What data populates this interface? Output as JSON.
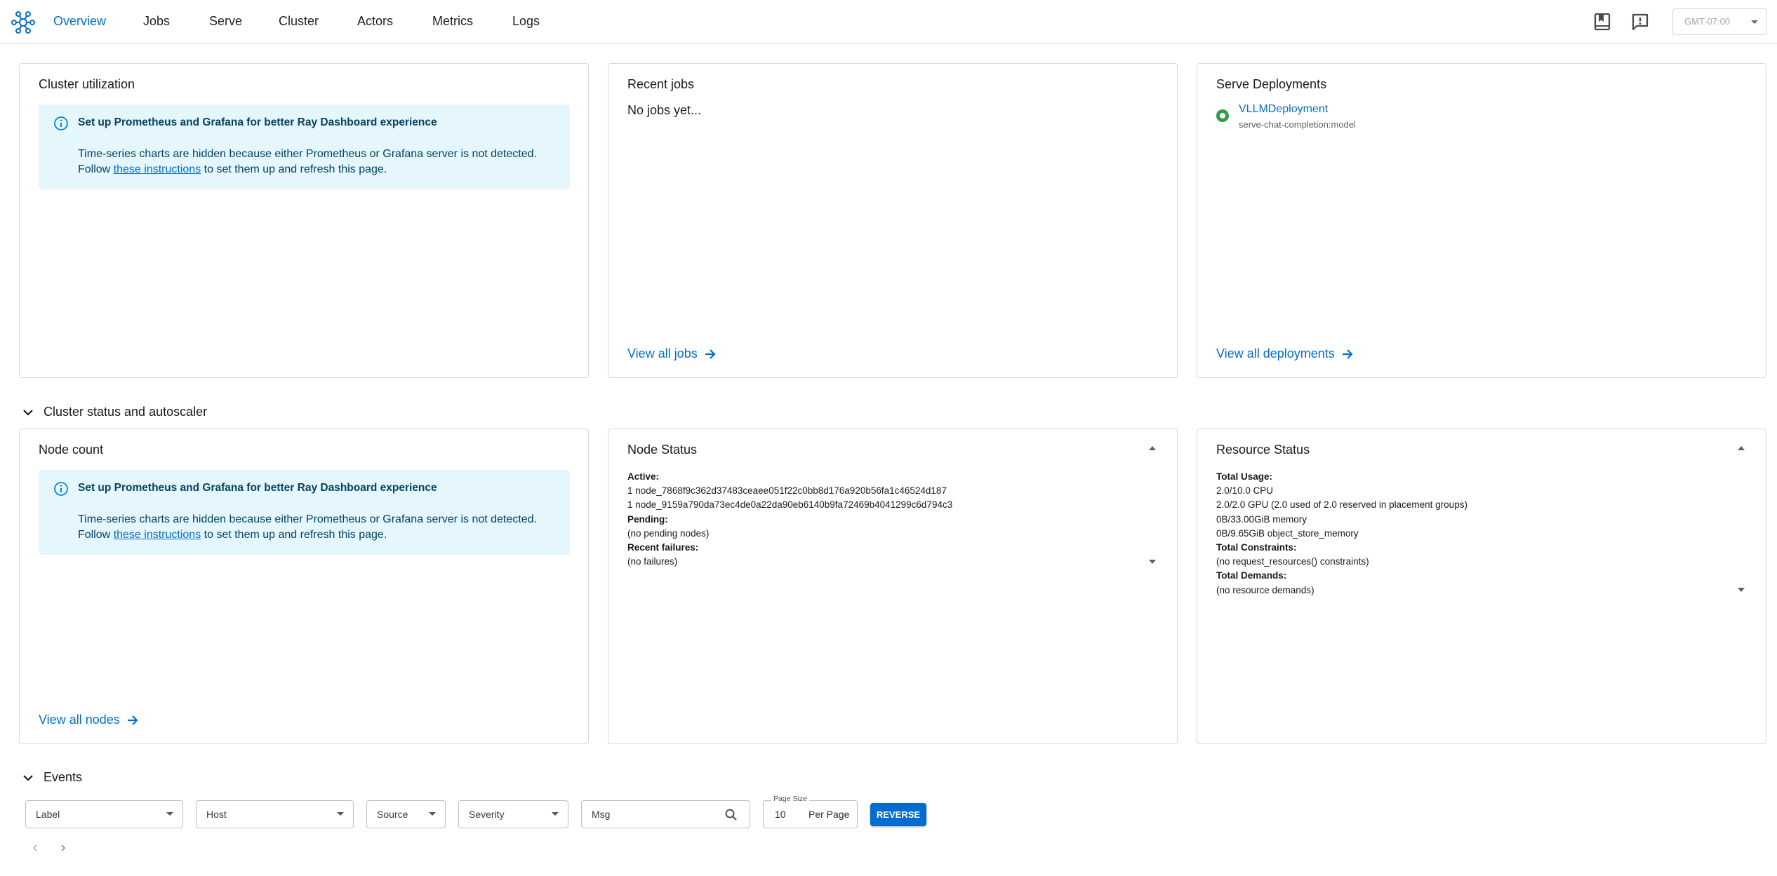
{
  "nav": {
    "items": [
      {
        "label": "Overview",
        "active": true
      },
      {
        "label": "Jobs"
      },
      {
        "label": "Serve"
      },
      {
        "label": "Cluster"
      },
      {
        "label": "Actors"
      },
      {
        "label": "Metrics"
      },
      {
        "label": "Logs"
      }
    ],
    "timezone": "GMT-07:00",
    "icons": [
      "ray-logo-icon",
      "docs-bookmark-icon",
      "feedback-icon"
    ]
  },
  "cluster_utilization": {
    "title": "Cluster utilization",
    "alert": {
      "title": "Set up Prometheus and Grafana for better Ray Dashboard experience",
      "line1": "Time-series charts are hidden because either Prometheus or Grafana server is not detected.",
      "follow": "Follow",
      "link": "these instructions",
      "rest": "to set them up and refresh this page."
    }
  },
  "recent_jobs": {
    "title": "Recent jobs",
    "empty": "No jobs yet...",
    "view_all": "View all jobs"
  },
  "serve_deployments": {
    "title": "Serve Deployments",
    "deployment_name": "VLLMDeployment",
    "deployment_route": "serve-chat-completion:model",
    "view_all": "View all deployments"
  },
  "cluster_status_section": {
    "label": "Cluster status and autoscaler"
  },
  "node_count": {
    "title": "Node count",
    "alert": {
      "title": "Set up Prometheus and Grafana for better Ray Dashboard experience",
      "line1": "Time-series charts are hidden because either Prometheus or Grafana server is not detected.",
      "follow": "Follow",
      "link": "these instructions",
      "rest": "to set them up and refresh this page."
    },
    "view_all": "View all nodes"
  },
  "node_status": {
    "title": "Node Status",
    "active_label": "Active:",
    "active_1": "1 node_7868f9c362d37483ceaee051f22c0bb8d176a920b56fa1c46524d187",
    "active_2": "1 node_9159a790da73ec4de0a22da90eb6140b9fa72469b4041299c6d794c3",
    "pending_label": "Pending:",
    "pending_value": "(no pending nodes)",
    "failures_label": "Recent failures:",
    "failures_value": "(no failures)"
  },
  "resource_status": {
    "title": "Resource Status",
    "usage_label": "Total Usage:",
    "cpu": "2.0/10.0 CPU",
    "gpu": "2.0/2.0 GPU (2.0 used of 2.0 reserved in placement groups)",
    "memory": "0B/33.00GiB memory",
    "object_store": "0B/9.65GiB object_store_memory",
    "constraints_label": "Total Constraints:",
    "constraints_value": "(no request_resources() constraints)",
    "demands_label": "Total Demands:",
    "demands_value": "(no resource demands)"
  },
  "events": {
    "label": "Events",
    "filters": {
      "label": "Label",
      "host": "Host",
      "source": "Source",
      "severity": "Severity",
      "msg": "Msg"
    },
    "page_size_legend": "Page Size",
    "page_size_value": "10",
    "per_page": "Per Page",
    "reverse": "REVERSE"
  },
  "colors": {
    "accent": "#036dcf",
    "alert_bg": "#e5f6fd",
    "status_green": "#2e9e46"
  }
}
